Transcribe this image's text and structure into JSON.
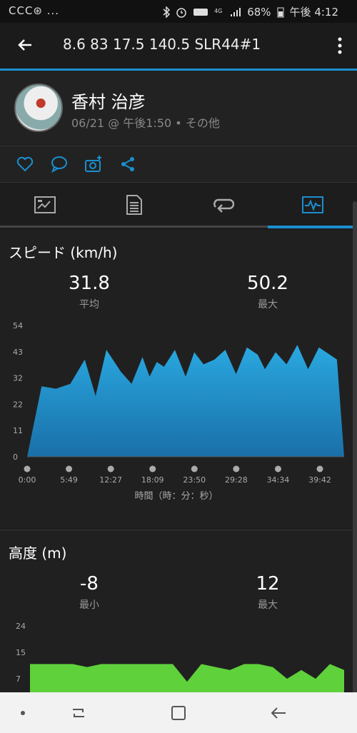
{
  "status": {
    "left_icons": "CCC⊛ ...",
    "battery_pct": "68%",
    "time": "午後 4:12"
  },
  "appbar": {
    "title": "8.6  83  17.5   140.5  SLR44#1"
  },
  "profile": {
    "name": "香村 治彦",
    "datetime": "06/21 @ 午後1:50 • その他"
  },
  "actions": [
    "heart-icon",
    "comment-icon",
    "add-photo-icon",
    "share-icon"
  ],
  "tabs": [
    {
      "icon": "summary-icon"
    },
    {
      "icon": "details-icon"
    },
    {
      "icon": "laps-icon"
    },
    {
      "icon": "chart-icon",
      "selected": true
    }
  ],
  "speed": {
    "title": "スピード (km/h)",
    "avg_value": "31.8",
    "avg_label": "平均",
    "max_value": "50.2",
    "max_label": "最大",
    "xlabel": "時間（時：分：秒）"
  },
  "altitude": {
    "title": "高度 (m)",
    "min_value": "-8",
    "min_label": "最小",
    "max_value": "12",
    "max_label": "最大"
  },
  "colors": {
    "accent": "#1a8fd0",
    "speed_fill_top": "#2aa8e0",
    "speed_fill_bottom": "#1a6fa8",
    "altitude_fill": "#5fd13b"
  },
  "chart_data": [
    {
      "type": "area",
      "ylim": [
        0,
        54
      ],
      "yticks": [
        "54",
        "43",
        "32",
        "22",
        "11",
        "0"
      ],
      "xticks": [
        "0:00",
        "5:49",
        "12:27",
        "18:09",
        "23:50",
        "29:28",
        "34:34",
        "39:42"
      ],
      "x": [
        0,
        2,
        4,
        6,
        8,
        9.5,
        11,
        13,
        14.5,
        16,
        17,
        18,
        19,
        20.5,
        22,
        23.2,
        24.5,
        26,
        27.5,
        29,
        30.5,
        32,
        33,
        34.5,
        36,
        37.5,
        39,
        40.5,
        42,
        43,
        44
      ],
      "values": [
        0,
        29,
        28,
        30,
        40,
        25,
        44,
        35,
        30,
        41,
        33,
        39,
        37,
        44,
        33,
        43,
        38,
        40,
        44,
        34,
        45,
        42,
        36,
        43,
        38,
        46,
        36,
        45,
        42,
        40,
        0
      ]
    },
    {
      "type": "area",
      "ylim": [
        0,
        24
      ],
      "yticks": [
        "24",
        "15",
        "7"
      ],
      "x": [
        0,
        2,
        4,
        6,
        8,
        10,
        12,
        14,
        16,
        18,
        20,
        22,
        24,
        26,
        28,
        30,
        32,
        34,
        36,
        38,
        40,
        42,
        44
      ],
      "values": [
        11,
        11,
        11,
        11,
        10,
        11,
        11,
        11,
        11,
        11,
        11,
        5,
        11,
        10,
        9,
        11,
        11,
        10,
        6,
        9,
        6,
        11,
        9
      ]
    }
  ]
}
